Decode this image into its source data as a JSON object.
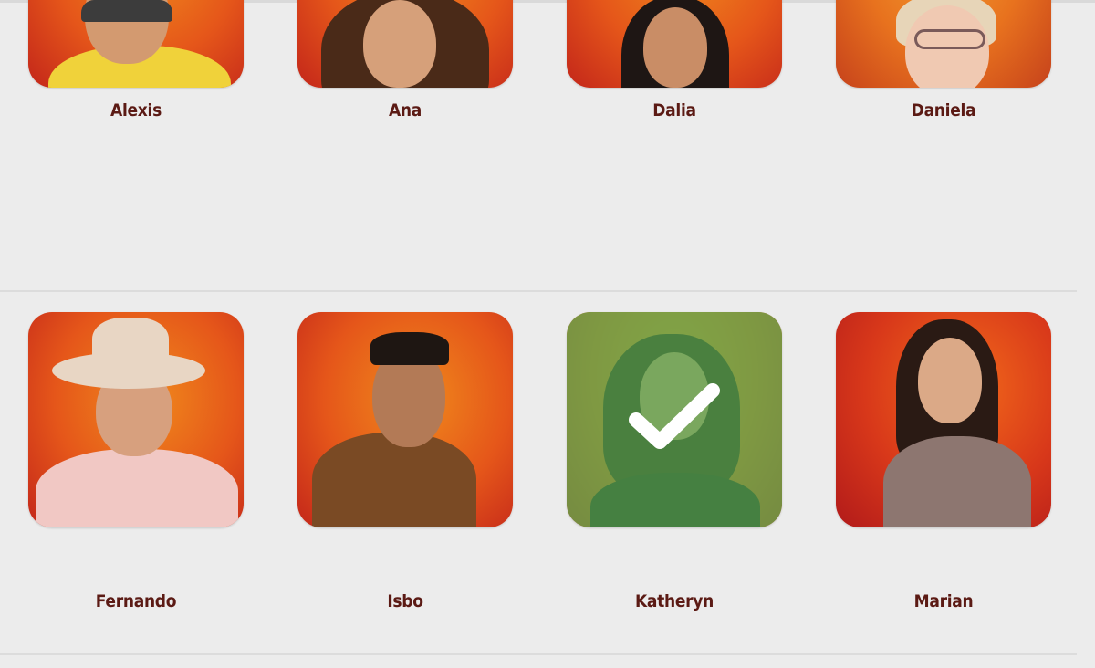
{
  "contestants_row1": [
    {
      "name": "Alexis"
    },
    {
      "name": "Ana"
    },
    {
      "name": "Dalia"
    },
    {
      "name": "Daniela"
    }
  ],
  "contestants_row2": [
    {
      "name": "Fernando"
    },
    {
      "name": "Isbo"
    },
    {
      "name": "Katheryn",
      "selected": true
    },
    {
      "name": "Marian"
    }
  ],
  "colors": {
    "page_background": "#ececec",
    "name_text": "#5b1a14",
    "photo_orange": "#e5561a",
    "selected_overlay": "#56a850",
    "check_mark": "#ffffff"
  }
}
